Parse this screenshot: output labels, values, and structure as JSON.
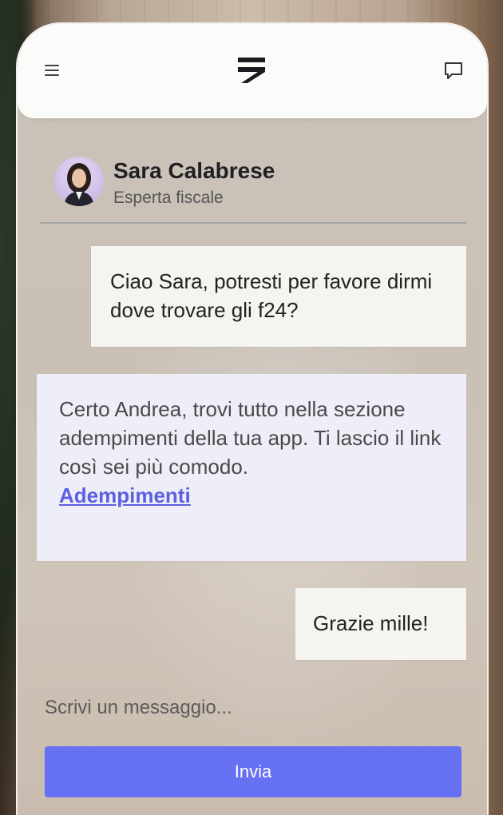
{
  "icons": {
    "menu": "menu-icon",
    "logo": "brand-logo-icon",
    "chat": "chat-bubble-icon"
  },
  "agent": {
    "name": "Sara Calabrese",
    "role": "Esperta fiscale"
  },
  "messages": [
    {
      "from": "user",
      "text": "Ciao Sara, potresti per favore dirmi dove trovare gli f24?"
    },
    {
      "from": "agent",
      "text": "Certo Andrea, trovi tutto nella sezione adempimenti della tua app. Ti lascio il link così sei più comodo.",
      "link": "Adempimenti"
    },
    {
      "from": "user",
      "text": "Grazie mille!"
    }
  ],
  "composer": {
    "placeholder": "Scrivi un messaggio...",
    "send_label": "Invia"
  },
  "colors": {
    "accent": "#6570f2",
    "link": "#5c5fe0",
    "agent_bubble": "#eeeef8",
    "user_bubble": "#f6f4f0"
  }
}
